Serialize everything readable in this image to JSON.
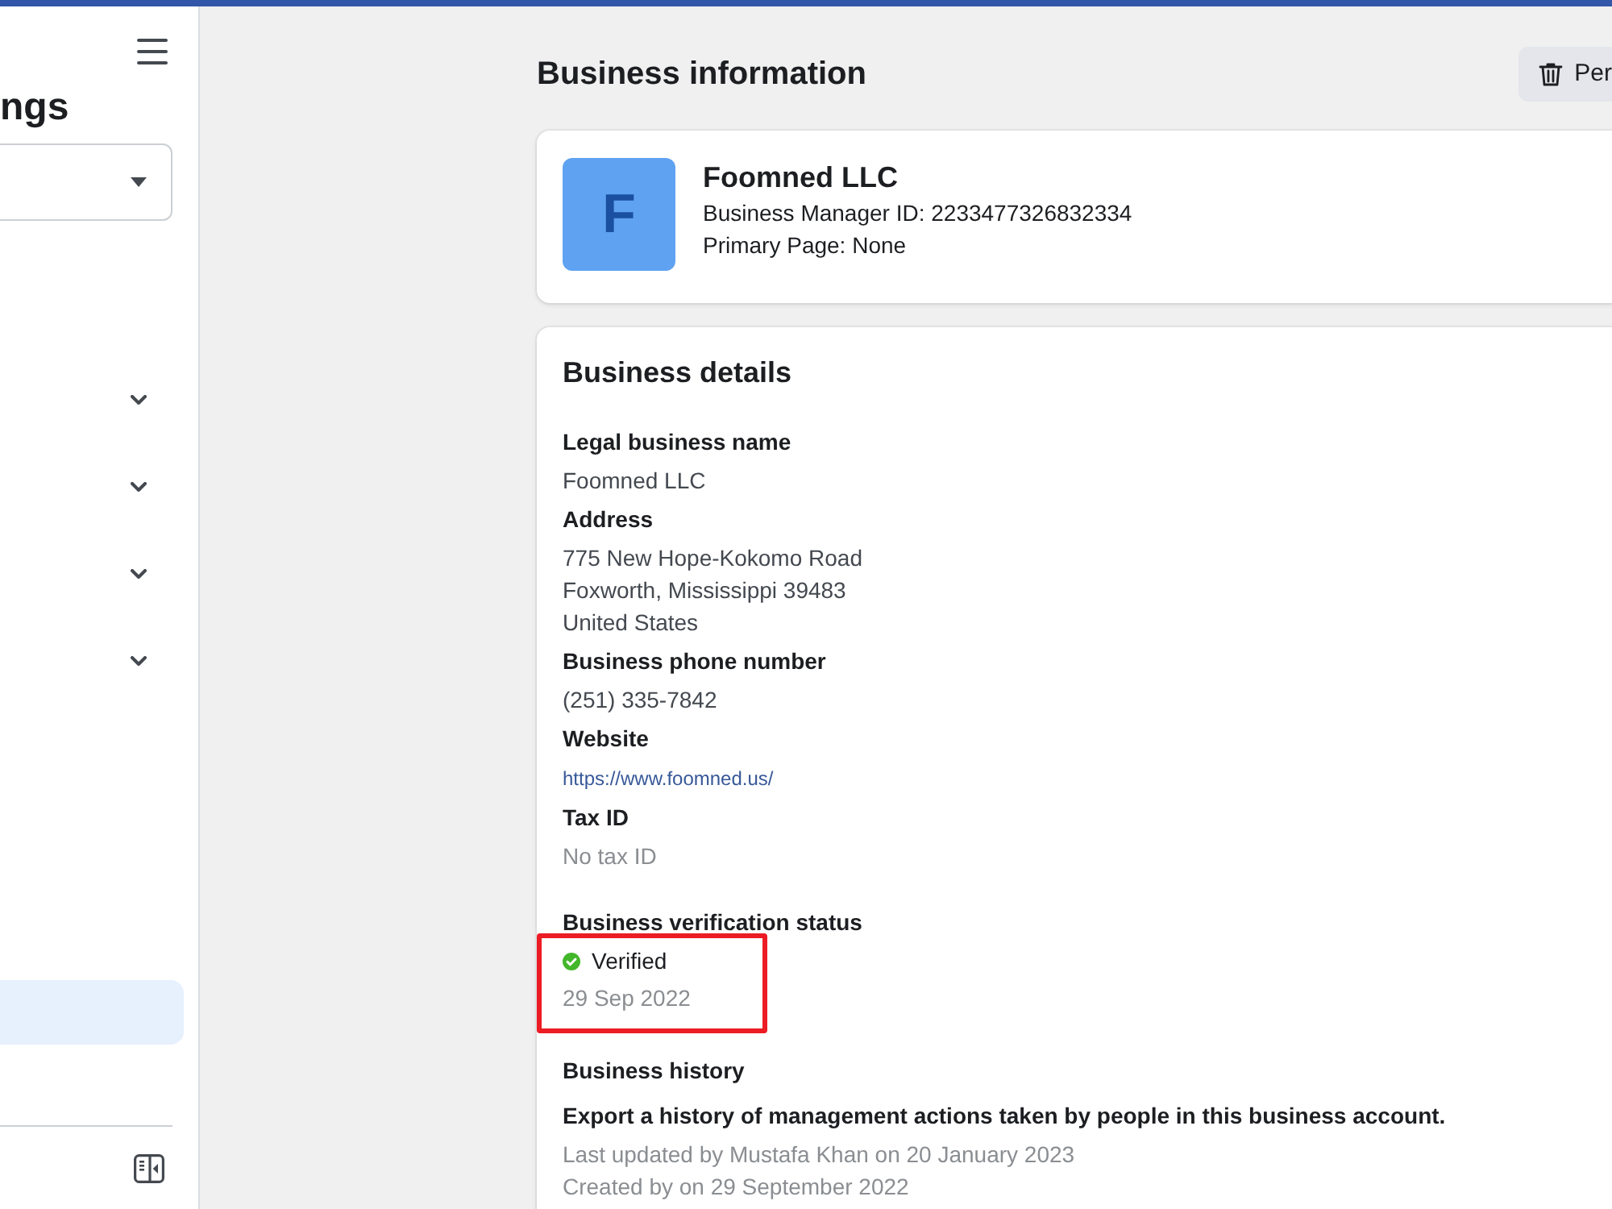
{
  "sidebar": {
    "title": "ngs",
    "items": [
      {
        "kind": "group",
        "expanded": false,
        "selected": false
      },
      {
        "kind": "group",
        "expanded": false,
        "selected": false
      },
      {
        "kind": "group",
        "expanded": false,
        "selected": false
      },
      {
        "kind": "group",
        "expanded": false,
        "selected": false
      },
      {
        "kind": "link",
        "selected": true
      }
    ]
  },
  "header": {
    "title": "Business information",
    "button": "Per"
  },
  "profile": {
    "initial": "F",
    "name": "Foomned LLC",
    "lines": [
      "Business Manager ID: 2233477326832334",
      "Primary Page: None"
    ]
  },
  "details": {
    "title": "Business details",
    "fields": [
      {
        "label": "Legal business name",
        "kind": "text",
        "values": [
          "Foomned LLC"
        ]
      },
      {
        "label": "Address",
        "kind": "text",
        "values": [
          "775 New Hope-Kokomo Road",
          "Foxworth, Mississippi 39483",
          "United States"
        ]
      },
      {
        "label": "Business phone number",
        "kind": "text",
        "values": [
          "(251) 335-7842"
        ]
      },
      {
        "label": "Website",
        "kind": "link",
        "values": [
          "https://www.foomned.us/"
        ]
      },
      {
        "label": "Tax ID",
        "kind": "empty",
        "values": [
          "No tax ID"
        ]
      }
    ]
  },
  "verification": {
    "label": "Business verification status",
    "status": "Verified",
    "verified": true,
    "date": "29 Sep 2022",
    "highlighted": true
  },
  "history": {
    "label": "Business history",
    "description": "Export a history of management actions taken by people in this business account.",
    "notes": [
      "Last updated by Mustafa Khan on 20 January 2023",
      "Created by on 29 September 2022"
    ]
  }
}
